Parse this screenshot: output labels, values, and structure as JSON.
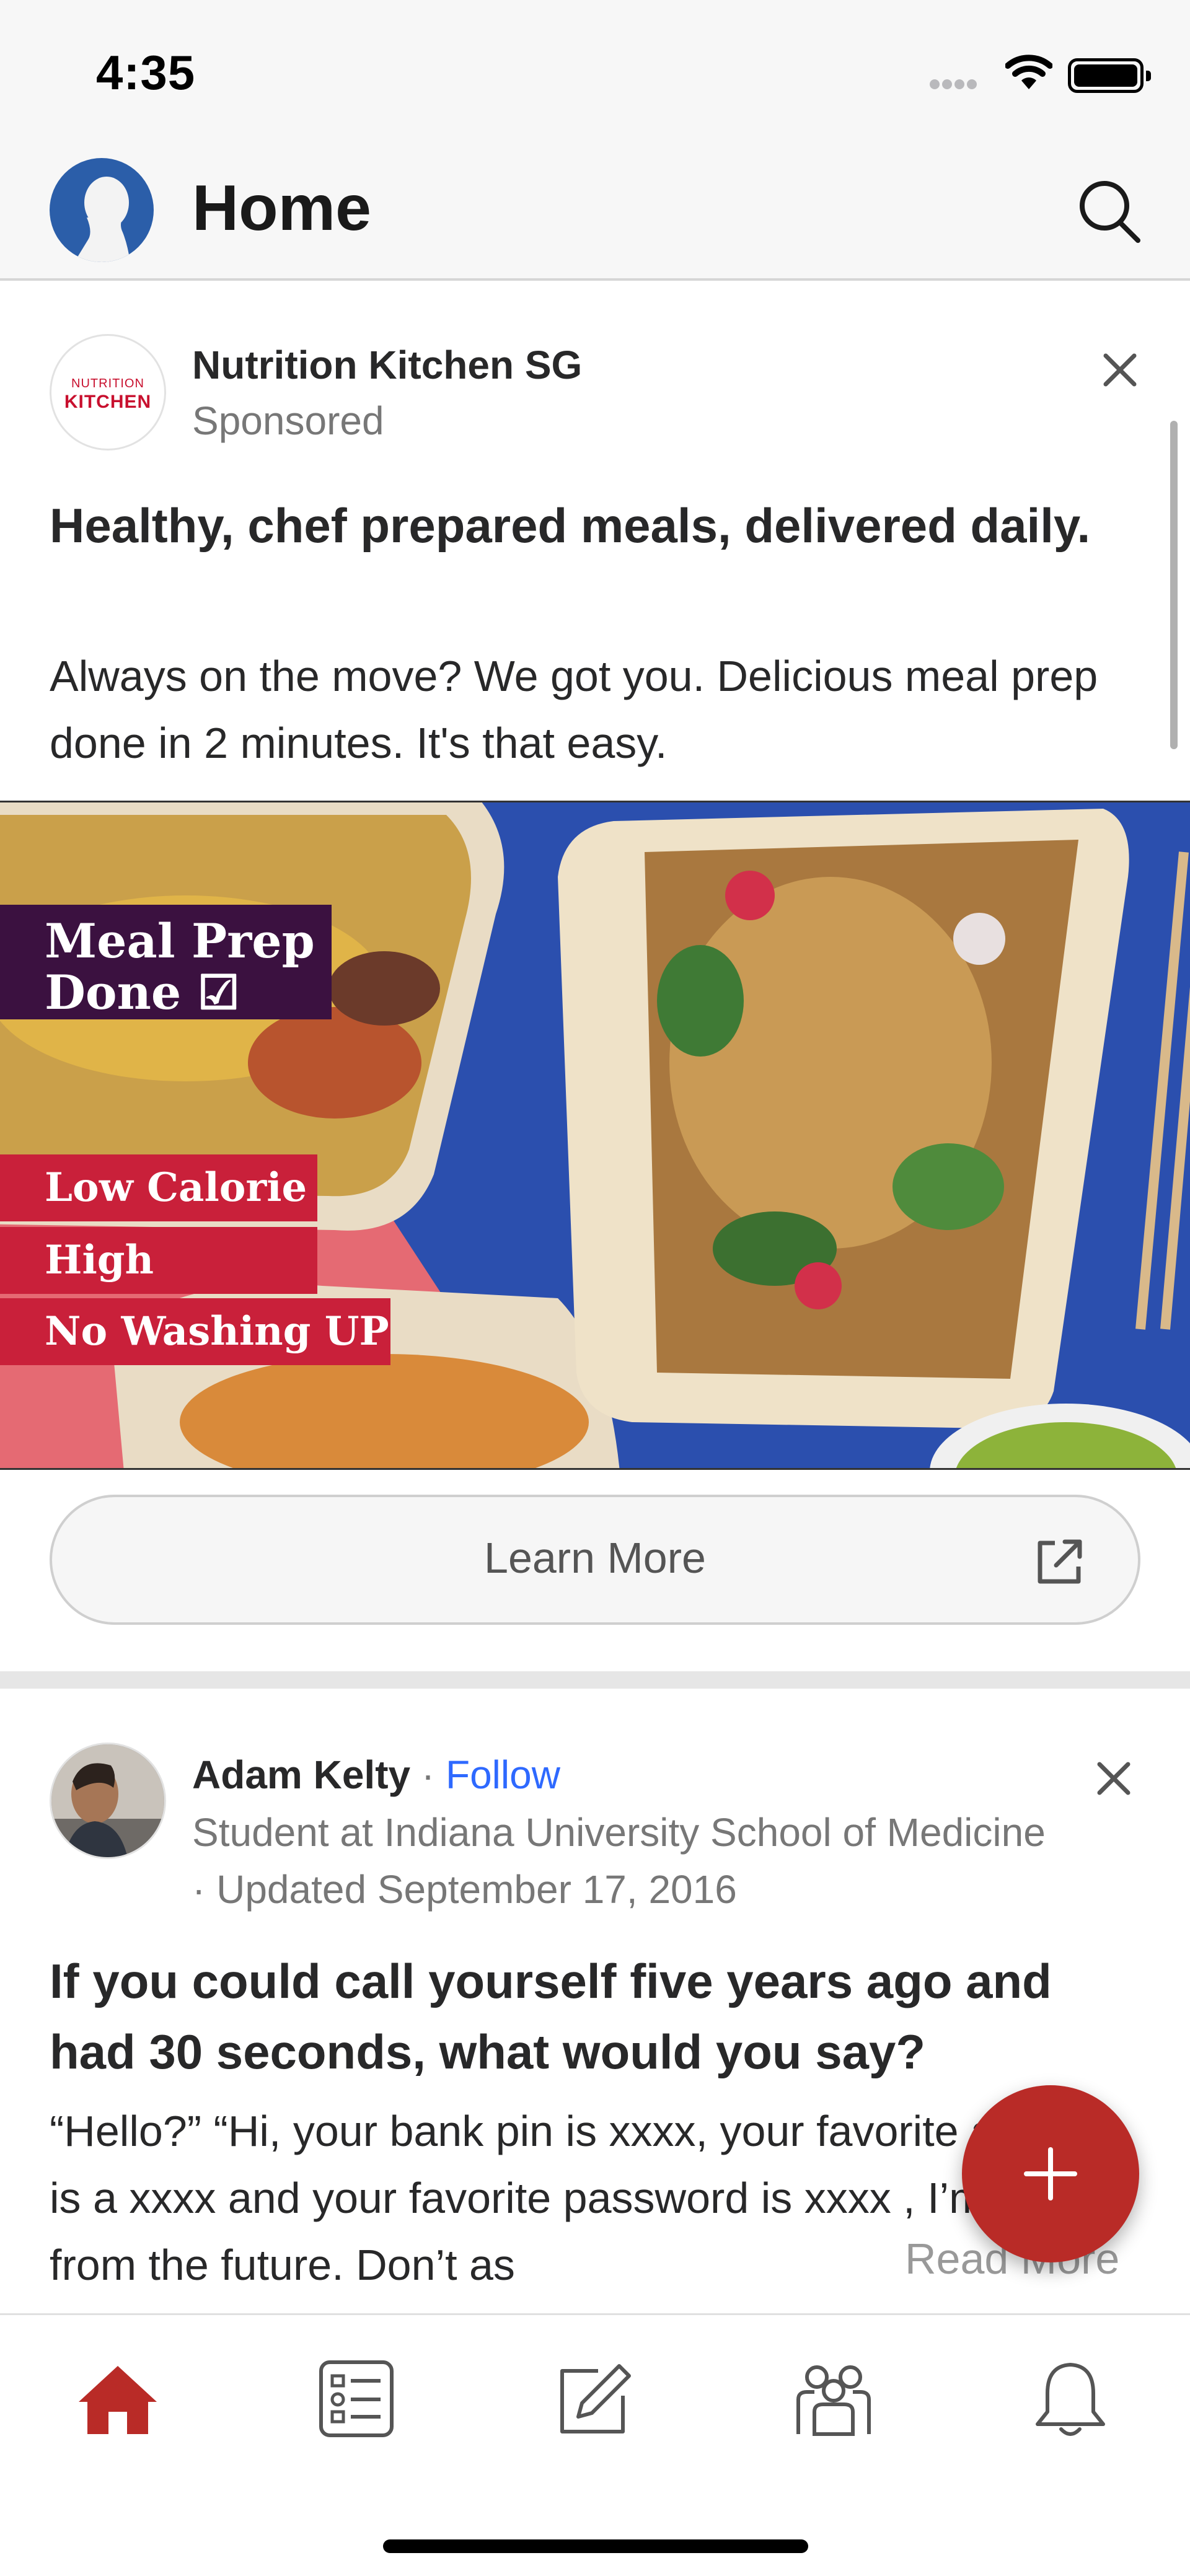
{
  "status_bar": {
    "time": "4:35"
  },
  "header": {
    "title": "Home"
  },
  "ad": {
    "advertiser": "Nutrition Kitchen SG",
    "logo_line1": "NUTRITION",
    "logo_line2": "KITCHEN",
    "sponsored_label": "Sponsored",
    "headline": "Healthy, chef prepared meals, delivered daily.",
    "body": "Always on the move? We got you. Delicious meal prep done in 2 minutes. It's that easy.",
    "image_tags": {
      "meal_prep_line1": "Meal Prep",
      "meal_prep_line2": "Done ☑",
      "tag1": "Low Calorie",
      "tag2": "High Protein",
      "tag3": "No Washing UP"
    },
    "cta_label": "Learn More"
  },
  "answer": {
    "author": "Adam Kelty",
    "separator": "·",
    "follow_label": "Follow",
    "credential": "Student at Indiana University School of Medicine",
    "updated": "· Updated September 17, 2016",
    "question": "If you could call yourself five years ago and had 30 seconds, what would you say?",
    "snippet": "“Hello?” “Hi, your bank pin is xxxx, your favorite animal is a xxxx and your favorite password is xxxx , I’m you from the future. Don’t as",
    "read_more_label": "Read More"
  },
  "tabs": [
    {
      "name": "home",
      "icon": "home-icon",
      "active": true
    },
    {
      "name": "following",
      "icon": "list-icon",
      "active": false
    },
    {
      "name": "answer",
      "icon": "pencil-icon",
      "active": false
    },
    {
      "name": "spaces",
      "icon": "people-icon",
      "active": false
    },
    {
      "name": "notifications",
      "icon": "bell-icon",
      "active": false
    }
  ],
  "colors": {
    "brand_red": "#b92b27",
    "link_blue": "#2e69ff",
    "header_bg": "#f7f7f7",
    "text_primary": "#282829",
    "text_secondary": "#777777"
  }
}
